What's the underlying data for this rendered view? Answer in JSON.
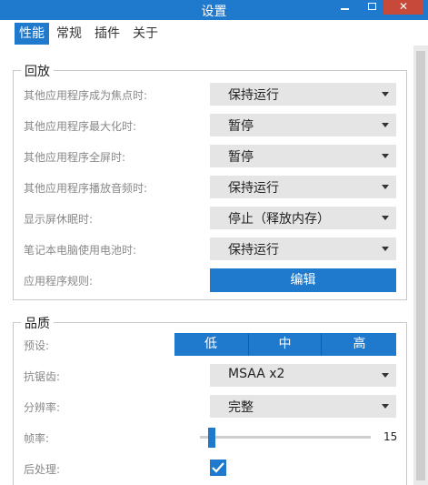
{
  "window": {
    "title": "设置"
  },
  "tabs": [
    "性能",
    "常规",
    "插件",
    "关于"
  ],
  "groups": {
    "playback": {
      "title": "回放",
      "rows": [
        {
          "label": "其他应用程序成为焦点时:",
          "value": "保持运行"
        },
        {
          "label": "其他应用程序最大化时:",
          "value": "暂停"
        },
        {
          "label": "其他应用程序全屏时:",
          "value": "暂停"
        },
        {
          "label": "其他应用程序播放音频时:",
          "value": "保持运行"
        },
        {
          "label": "显示屏休眠时:",
          "value": "停止（释放内存）"
        },
        {
          "label": "笔记本电脑使用电池时:",
          "value": "保持运行"
        }
      ],
      "rules_label": "应用程序规则:",
      "rules_button": "编辑"
    },
    "quality": {
      "title": "品质",
      "preset_label": "预设:",
      "presets": [
        "低",
        "中",
        "高"
      ],
      "antialias_label": "抗锯齿:",
      "antialias_value": "MSAA x2",
      "resolution_label": "分辨率:",
      "resolution_value": "完整",
      "fps_label": "帧率:",
      "fps_value": "15",
      "fps_level": 0.06,
      "postprocess_label": "后处理:",
      "postprocess_checked": true
    }
  }
}
